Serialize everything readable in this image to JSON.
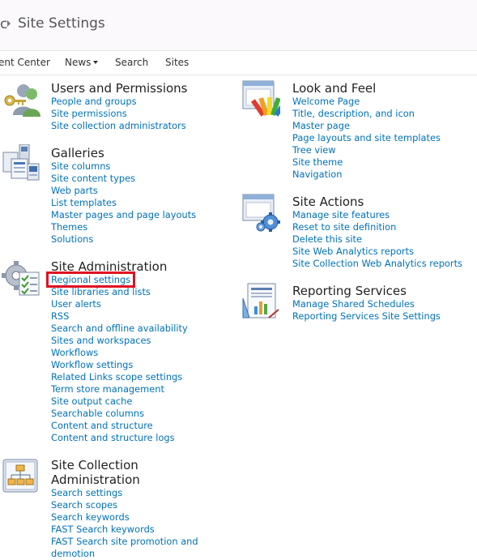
{
  "breadcrumb": {
    "partial": "c",
    "title": "Site Settings"
  },
  "nav": [
    {
      "label": "ent Center",
      "dropdown": false
    },
    {
      "label": "News",
      "dropdown": true
    },
    {
      "label": "Search",
      "dropdown": false
    },
    {
      "label": "Sites",
      "dropdown": false
    }
  ],
  "sections": {
    "users": {
      "title": "Users and Permissions",
      "icon": "users-icon",
      "links": [
        "People and groups",
        "Site permissions",
        "Site collection administrators"
      ]
    },
    "galleries": {
      "title": "Galleries",
      "icon": "galleries-icon",
      "links": [
        "Site columns",
        "Site content types",
        "Web parts",
        "List templates",
        "Master pages and page layouts",
        "Themes",
        "Solutions"
      ]
    },
    "site_admin": {
      "title": "Site Administration",
      "icon": "site-admin-icon",
      "links": [
        "Regional settings",
        "Site libraries and lists",
        "User alerts",
        "RSS",
        "Search and offline availability",
        "Sites and workspaces",
        "Workflows",
        "Workflow settings",
        "Related Links scope settings",
        "Term store management",
        "Site output cache",
        "Searchable columns",
        "Content and structure",
        "Content and structure logs"
      ]
    },
    "site_collection": {
      "title_line1": "Site Collection",
      "title_line2": "Administration",
      "icon": "site-collection-icon",
      "links": [
        "Search settings",
        "Search scopes",
        "Search keywords",
        "FAST Search keywords",
        "FAST Search site promotion and",
        "demotion"
      ]
    },
    "look_feel": {
      "title": "Look and Feel",
      "icon": "look-and-feel-icon",
      "links": [
        "Welcome Page",
        "Title, description, and icon",
        "Master page",
        "Page layouts and site templates",
        "Tree view",
        "Site theme",
        "Navigation"
      ]
    },
    "site_actions": {
      "title": "Site Actions",
      "icon": "site-actions-icon",
      "links": [
        "Manage site features",
        "Reset to site definition",
        "Delete this site",
        "Site Web Analytics reports",
        "Site Collection Web Analytics reports"
      ]
    },
    "reporting": {
      "title": "Reporting Services",
      "icon": "reporting-services-icon",
      "links": [
        "Manage Shared Schedules",
        "Reporting Services Site Settings"
      ]
    }
  },
  "highlight_color": "#e01020",
  "link_color": "#0072bc"
}
